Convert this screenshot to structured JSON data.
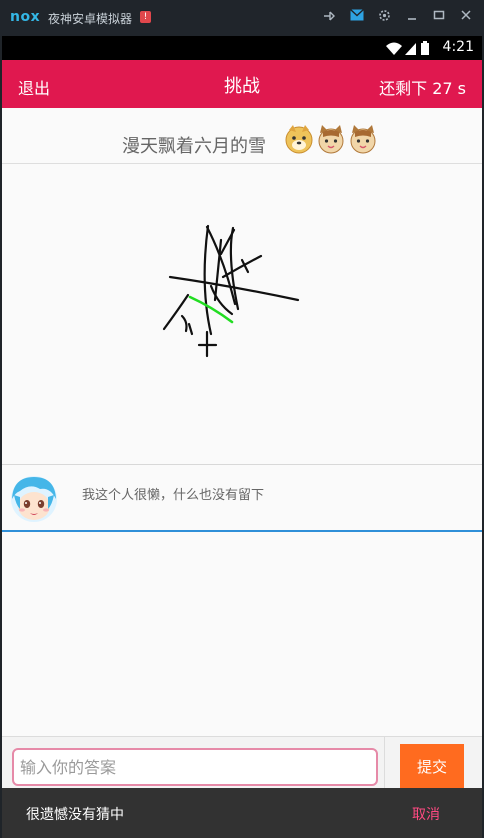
{
  "emulator": {
    "logo": "nox",
    "title": "夜神安卓模拟器",
    "alert_badge": "!",
    "controls": [
      "pin-icon",
      "mail-icon",
      "settings-icon",
      "minimize-icon",
      "maximize-icon",
      "close-icon"
    ]
  },
  "status_bar": {
    "time": "4:21",
    "icons": [
      "wifi-icon",
      "signal-icon",
      "battery-icon"
    ]
  },
  "app_bar": {
    "back_label": "退出",
    "title": "挑战",
    "timer": "还剩下 27 s",
    "color": "#e0184f"
  },
  "hint": {
    "text": "漫天飘着六月的雪",
    "emojis": [
      "doge-emoji",
      "cat-emoji",
      "cat-emoji"
    ]
  },
  "profile": {
    "signature": "我这个人很懒，什么也没有留下",
    "avatar": "anime-avatar"
  },
  "answer": {
    "placeholder": "输入你的答案",
    "value": ""
  },
  "submit": {
    "label": "提交",
    "color": "#ff6b1f"
  },
  "snackbar": {
    "message": "很遗憾没有猜中",
    "action": "取消",
    "action_color": "#ff4a82"
  }
}
